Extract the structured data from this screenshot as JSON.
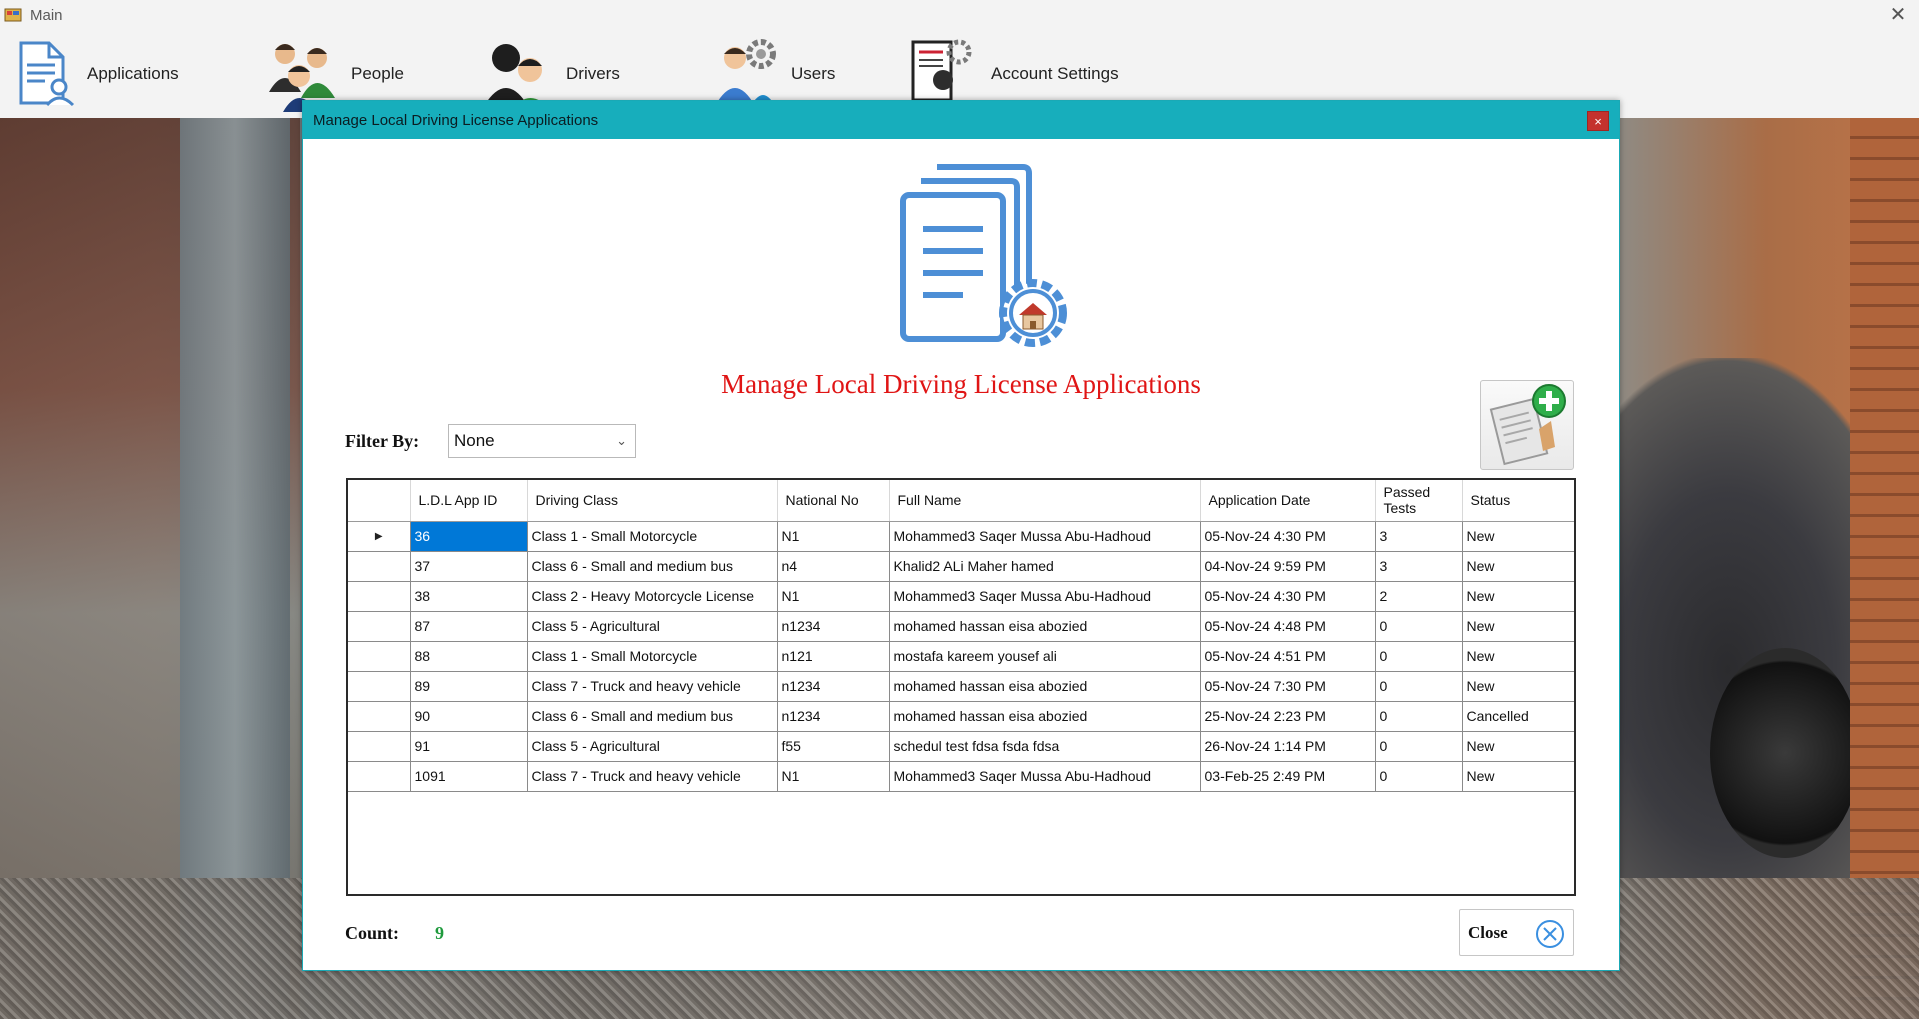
{
  "window": {
    "title": "Main"
  },
  "menu": {
    "items": [
      {
        "label": "Applications"
      },
      {
        "label": "People"
      },
      {
        "label": "Drivers"
      },
      {
        "label": "Users"
      },
      {
        "label": "Account Settings"
      }
    ]
  },
  "dialog": {
    "title": "Manage Local Driving License Applications",
    "close_glyph": "×",
    "heading": "Manage Local Driving License Applications",
    "filter": {
      "label": "Filter By:",
      "selected": "None"
    },
    "grid": {
      "columns": [
        "L.D.L App ID",
        "Driving Class",
        "National No",
        "Full Name",
        "Application Date",
        "Passed Tests",
        "Status"
      ],
      "rows": [
        [
          "36",
          "Class 1 - Small Motorcycle",
          "N1",
          "Mohammed3 Saqer Mussa Abu-Hadhoud",
          "05-Nov-24 4:30 PM",
          "3",
          "New"
        ],
        [
          "37",
          "Class 6 - Small and medium bus",
          "n4",
          "Khalid2 ALi Maher hamed",
          "04-Nov-24 9:59 PM",
          "3",
          "New"
        ],
        [
          "38",
          "Class 2 - Heavy Motorcycle License",
          "N1",
          "Mohammed3 Saqer Mussa Abu-Hadhoud",
          "05-Nov-24 4:30 PM",
          "2",
          "New"
        ],
        [
          "87",
          "Class 5 - Agricultural",
          "n1234",
          "mohamed hassan eisa abozied",
          "05-Nov-24 4:48 PM",
          "0",
          "New"
        ],
        [
          "88",
          "Class 1 - Small Motorcycle",
          "n121",
          "mostafa kareem yousef ali",
          "05-Nov-24 4:51 PM",
          "0",
          "New"
        ],
        [
          "89",
          "Class 7 - Truck and heavy vehicle",
          "n1234",
          "mohamed hassan eisa abozied",
          "05-Nov-24 7:30 PM",
          "0",
          "New"
        ],
        [
          "90",
          "Class 6 - Small and medium bus",
          "n1234",
          "mohamed hassan eisa abozied",
          "25-Nov-24 2:23 PM",
          "0",
          "Cancelled"
        ],
        [
          "91",
          "Class 5 - Agricultural",
          "f55",
          "schedul test fdsa fsda fdsa",
          "26-Nov-24 1:14 PM",
          "0",
          "New"
        ],
        [
          "1091",
          "Class 7 - Truck and heavy vehicle",
          "N1",
          "Mohammed3 Saqer Mussa Abu-Hadhoud",
          "03-Feb-25 2:49 PM",
          "0",
          "New"
        ]
      ]
    },
    "count": {
      "label": "Count:",
      "value": "9"
    },
    "close_button": {
      "label": "Close"
    }
  },
  "colors": {
    "accent": "#17aebc",
    "heading": "#e01515",
    "selection": "#0078d7",
    "count": "#1f9a3d"
  },
  "icons": [
    "applications-icon",
    "people-icon",
    "drivers-icon",
    "users-icon",
    "account-settings-icon",
    "document-gear-icon",
    "add-document-icon",
    "close-circle-icon"
  ]
}
